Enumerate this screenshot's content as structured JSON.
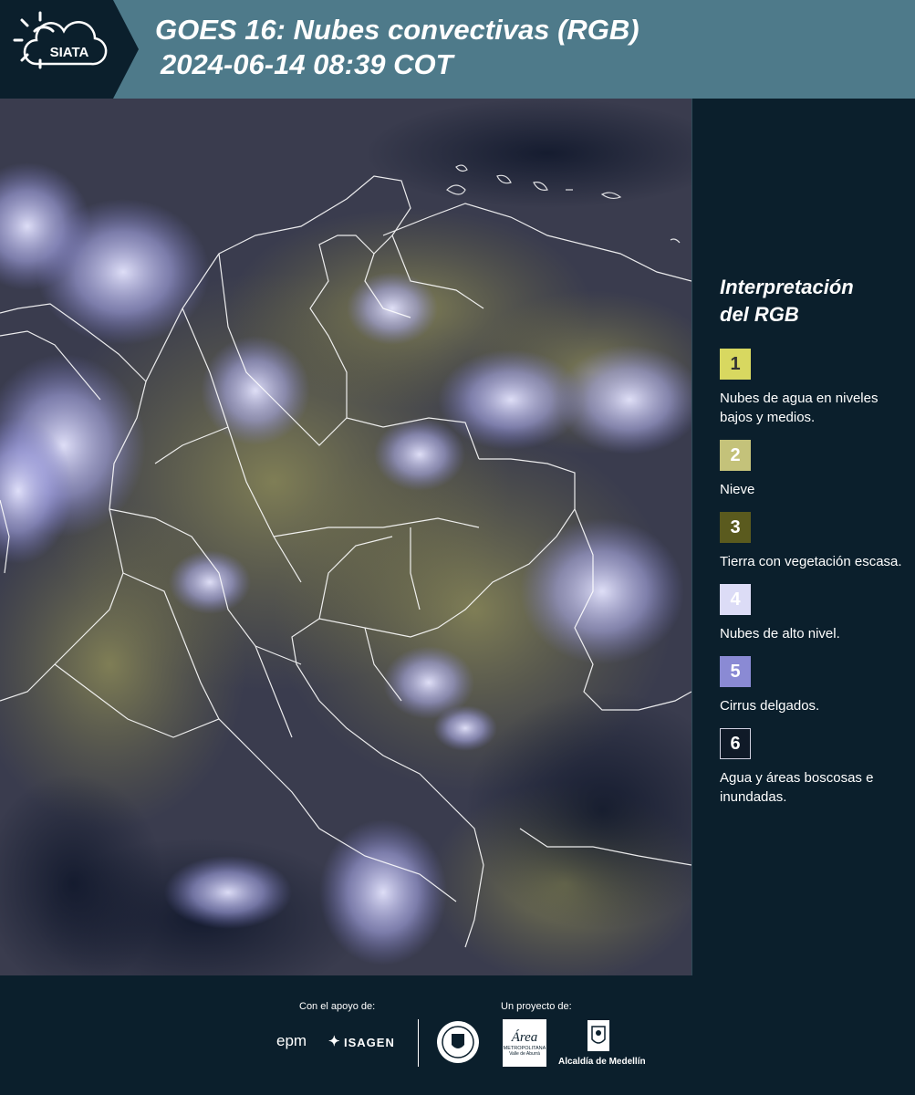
{
  "header": {
    "logo_text": "SIATA",
    "title_line1": "GOES 16: Nubes convectivas (RGB)",
    "title_line2": "2024-06-14 08:39 COT"
  },
  "legend": {
    "title_line1": "Interpretación",
    "title_line2": "del RGB",
    "items": [
      {
        "number": "1",
        "label": "Nubes de agua en niveles bajos y medios.",
        "color": "#d8d860",
        "text_color": "#333333"
      },
      {
        "number": "2",
        "label": "Nieve",
        "color": "#c4c27a",
        "text_color": "#ffffff"
      },
      {
        "number": "3",
        "label": "Tierra con vegetación escasa.",
        "color": "#5a5a1e",
        "text_color": "#ffffff"
      },
      {
        "number": "4",
        "label": "Nubes de alto nivel.",
        "color": "#dcdcf6",
        "text_color": "#ffffff"
      },
      {
        "number": "5",
        "label": "Cirrus delgados.",
        "color": "#8a8ad4",
        "text_color": "#ffffff"
      },
      {
        "number": "6",
        "label": "Agua y áreas boscosas e inundadas.",
        "color": "#101a28",
        "text_color": "#ffffff"
      }
    ]
  },
  "footer": {
    "support_label": "Con el apoyo de:",
    "project_label": "Un proyecto de:",
    "epm": "epm",
    "isagen": "ISAGEN",
    "area_metropolitana": "Área",
    "area_sub": "METROPOLITANA",
    "area_sub2": "Valle de Aburrá",
    "alcaldia": "Alcaldía de Medellín"
  },
  "map": {
    "satellite": "GOES 16",
    "product": "Nubes convectivas (RGB)"
  }
}
